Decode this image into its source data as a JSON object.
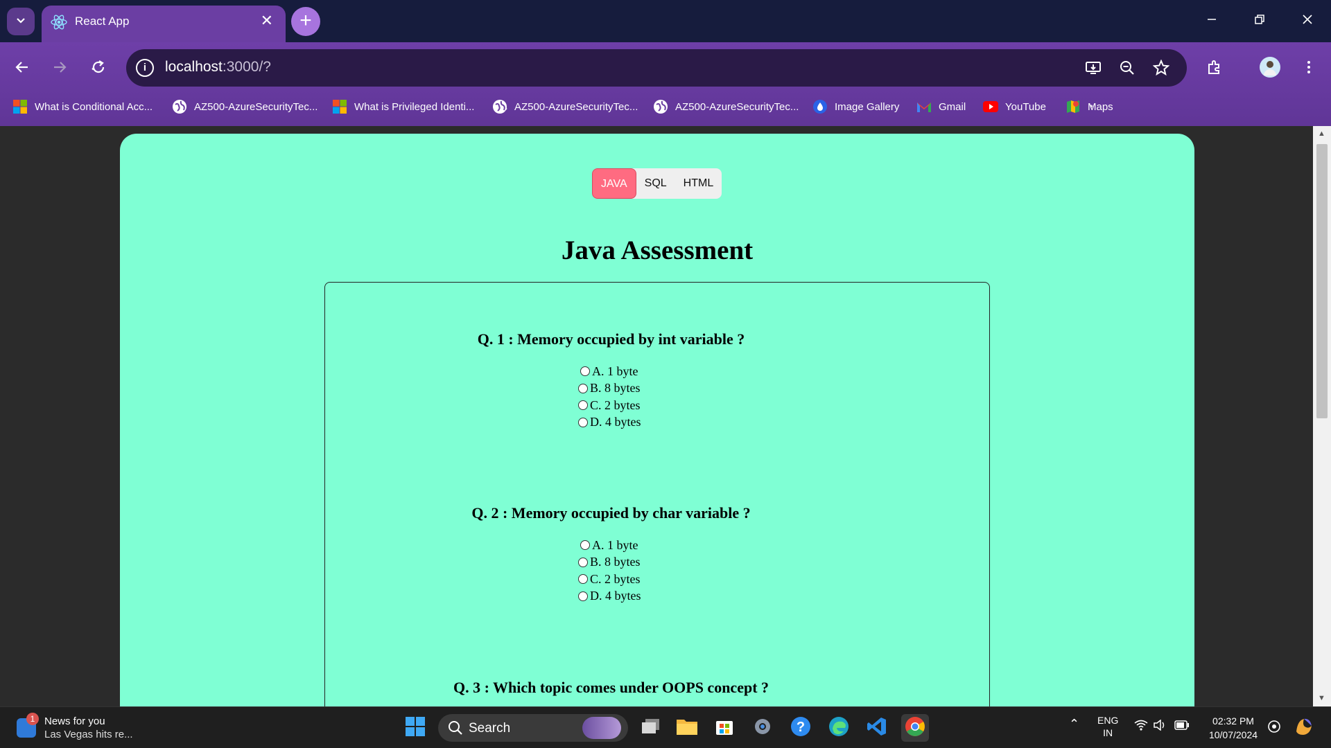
{
  "browser": {
    "tab_title": "React App",
    "url_host": "localhost",
    "url_path": ":3000/?",
    "bookmarks": [
      {
        "label": "What is Conditional Acc...",
        "icon": "microsoft-icon"
      },
      {
        "label": "AZ500-AzureSecurityTec...",
        "icon": "globe-icon"
      },
      {
        "label": "What is Privileged Identi...",
        "icon": "microsoft-icon"
      },
      {
        "label": "AZ500-AzureSecurityTec...",
        "icon": "globe-icon"
      },
      {
        "label": "AZ500-AzureSecurityTec...",
        "icon": "globe-icon"
      },
      {
        "label": "Image Gallery",
        "icon": "droplet-icon"
      },
      {
        "label": "Gmail",
        "icon": "gmail-icon"
      },
      {
        "label": "YouTube",
        "icon": "youtube-icon"
      },
      {
        "label": "Maps",
        "icon": "maps-icon"
      }
    ]
  },
  "page": {
    "tabs": [
      "JAVA",
      "SQL",
      "HTML"
    ],
    "active_tab": "JAVA",
    "title": "Java Assessment",
    "questions": [
      {
        "text": "Q. 1 : Memory occupied by int variable ?",
        "options": [
          "A. 1 byte",
          "B. 8 bytes",
          "C. 2 bytes",
          "D. 4 bytes"
        ]
      },
      {
        "text": "Q. 2 : Memory occupied by char variable ?",
        "options": [
          "A. 1 byte",
          "B. 8 bytes",
          "C. 2 bytes",
          "D. 4 bytes"
        ]
      },
      {
        "text": "Q. 3 : Which topic comes under OOPS concept ?",
        "options": []
      }
    ]
  },
  "taskbar": {
    "news_title": "News for you",
    "news_subtitle": "Las Vegas hits re...",
    "news_badge": "1",
    "search_label": "Search",
    "lang_1": "ENG",
    "lang_2": "IN",
    "time": "02:32 PM",
    "date": "10/07/2024"
  },
  "colors": {
    "page_background": "#7fffd4",
    "active_tab": "#ff6b81",
    "browser_frame": "#6b3ea3",
    "title_bar": "#161c3d"
  }
}
